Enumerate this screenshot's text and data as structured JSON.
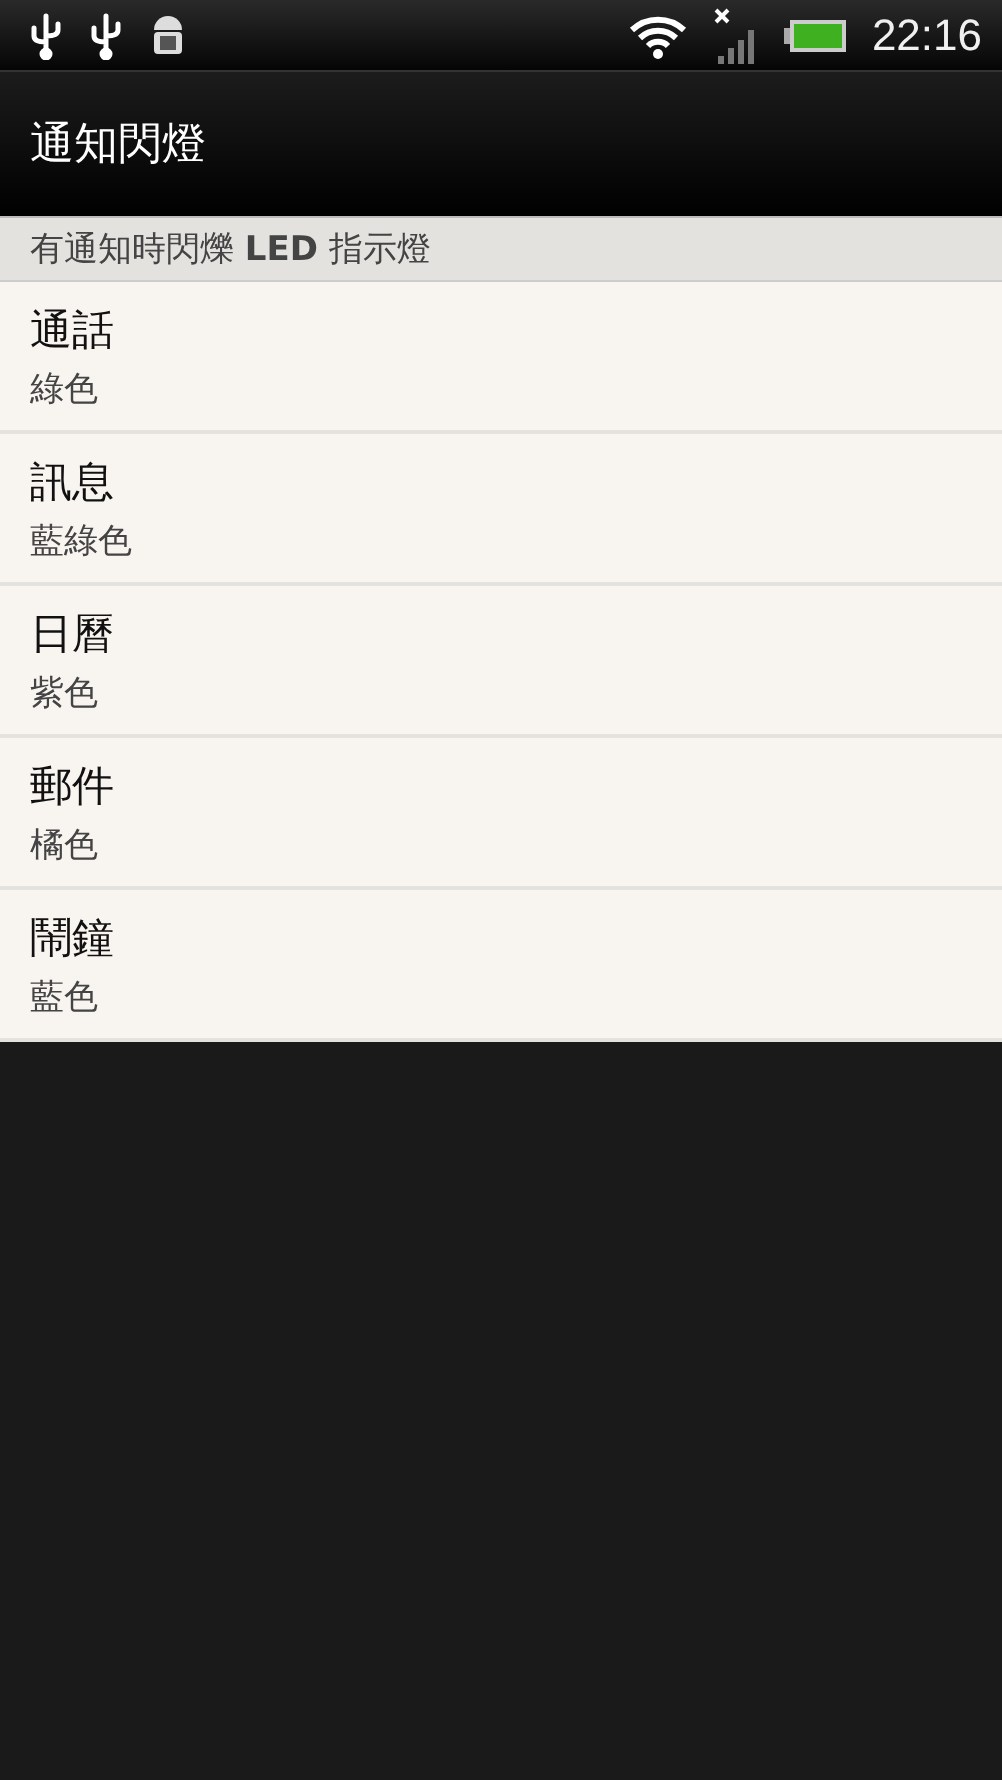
{
  "status_bar": {
    "time": "22:16"
  },
  "title_bar": {
    "title": "通知閃燈"
  },
  "section": {
    "header": "有通知時閃爍 **LED** 指示燈",
    "items": [
      {
        "title": "通話",
        "summary": "綠色"
      },
      {
        "title": "訊息",
        "summary": "藍綠色"
      },
      {
        "title": "日曆",
        "summary": "紫色"
      },
      {
        "title": "郵件",
        "summary": "橘色"
      },
      {
        "title": "鬧鐘",
        "summary": "藍色"
      }
    ]
  }
}
